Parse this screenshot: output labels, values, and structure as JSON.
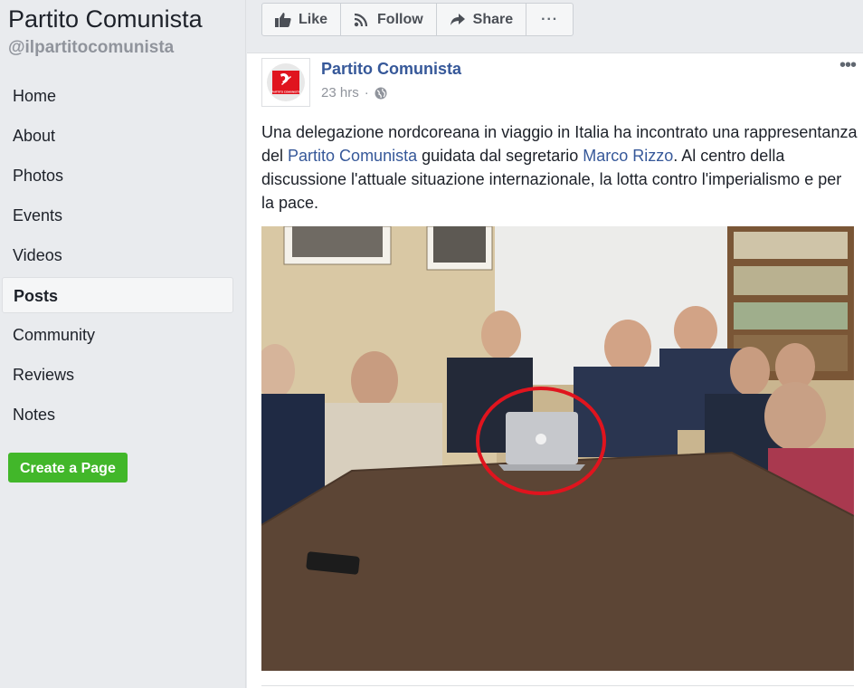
{
  "sidebar": {
    "page_name": "Partito Comunista",
    "page_handle": "@ilpartitocomunista",
    "items": [
      {
        "label": "Home"
      },
      {
        "label": "About"
      },
      {
        "label": "Photos"
      },
      {
        "label": "Events"
      },
      {
        "label": "Videos"
      },
      {
        "label": "Posts",
        "active": true
      },
      {
        "label": "Community"
      },
      {
        "label": "Reviews"
      },
      {
        "label": "Notes"
      }
    ],
    "create_button": "Create a Page"
  },
  "actionbar": {
    "like": "Like",
    "follow": "Follow",
    "share": "Share",
    "more": "···"
  },
  "post": {
    "author": "Partito Comunista",
    "time": "23 hrs",
    "more": "•••",
    "avatar_text": "PARTITO COMUNISTA",
    "text_1": "Una delegazione nordcoreana in viaggio in Italia ha incontrato una rappresentanza del ",
    "link_1": "Partito Comunista",
    "text_2": " guidata dal segretario ",
    "link_2": "Marco Rizzo",
    "text_3": ". Al centro della discussione l'attuale situazione internazionale, la lotta contro l'imperialismo e per la pace."
  },
  "colors": {
    "link": "#365899",
    "green": "#42b72a",
    "highlight_circle": "#e0141e"
  }
}
